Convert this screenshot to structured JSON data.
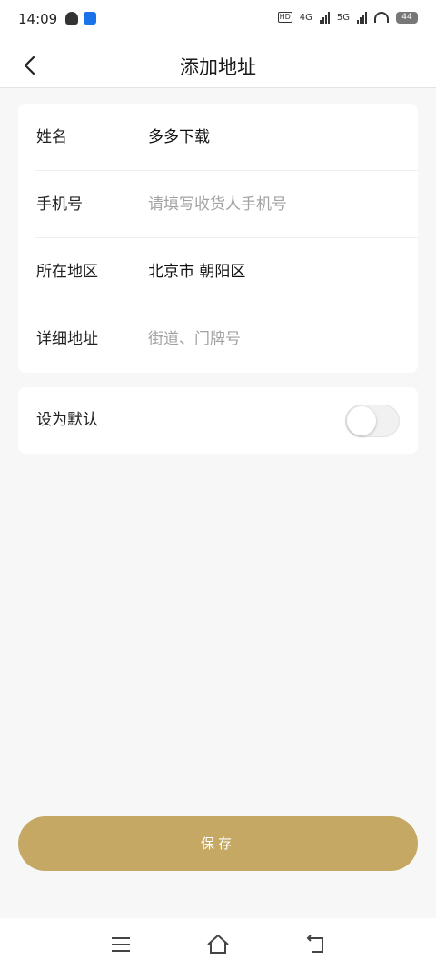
{
  "status_bar": {
    "time": "14:09",
    "hd_label": "HD",
    "net1": "4G",
    "net2": "5G",
    "battery": "44"
  },
  "nav": {
    "title": "添加地址",
    "back_icon": "chevron-left-icon"
  },
  "form": {
    "name": {
      "label": "姓名",
      "value": "多多下载"
    },
    "phone": {
      "label": "手机号",
      "placeholder": "请填写收货人手机号"
    },
    "region": {
      "label": "所在地区",
      "value": "北京市 朝阳区"
    },
    "detail": {
      "label": "详细地址",
      "placeholder": "街道、门牌号"
    }
  },
  "default_toggle": {
    "label": "设为默认",
    "on": false
  },
  "save_button": {
    "label": "保存"
  },
  "colors": {
    "accent": "#c4a863",
    "background": "#f7f7f7"
  }
}
